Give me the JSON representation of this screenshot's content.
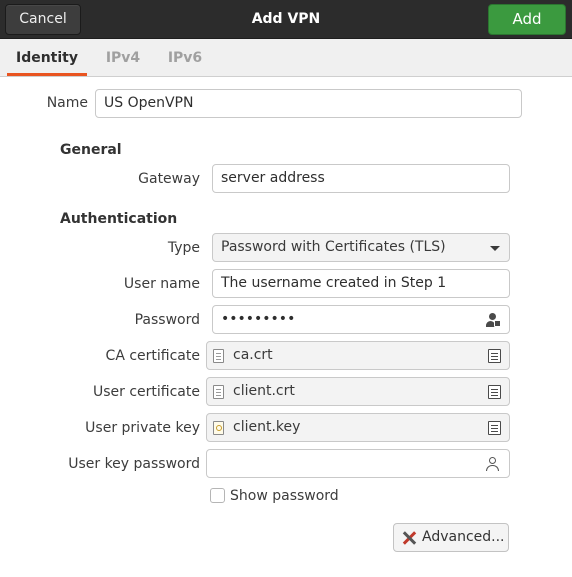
{
  "header": {
    "title": "Add VPN",
    "cancel_label": "Cancel",
    "add_label": "Add",
    "add_color": "#3b9a3f"
  },
  "tabs": [
    {
      "label": "Identity",
      "active": true
    },
    {
      "label": "IPv4",
      "active": false
    },
    {
      "label": "IPv6",
      "active": false
    }
  ],
  "accent_color": "#e95420",
  "form": {
    "name_label": "Name",
    "name_value": "US OpenVPN",
    "general_heading": "General",
    "gateway_label": "Gateway",
    "gateway_value": "server address",
    "authentication_heading": "Authentication",
    "type_label": "Type",
    "type_value": "Password with Certificates (TLS)",
    "username_label": "User name",
    "username_value": "The username created in Step 1",
    "password_label": "Password",
    "password_value": "•••••••••",
    "ca_cert_label": "CA certificate",
    "ca_cert_value": "ca.crt",
    "user_cert_label": "User certificate",
    "user_cert_value": "client.crt",
    "user_key_label": "User private key",
    "user_key_value": "client.key",
    "user_key_password_label": "User key password",
    "user_key_password_value": "",
    "show_password_label": "Show password",
    "show_password_checked": false,
    "advanced_label": "Advanced..."
  },
  "icons": {
    "password_field": "user-lock-icon",
    "key_password_field": "user-icon",
    "file_chooser": "file-browse-icon",
    "cert_file": "document-icon",
    "key_file": "key-file-icon",
    "advanced": "tools-icon"
  }
}
